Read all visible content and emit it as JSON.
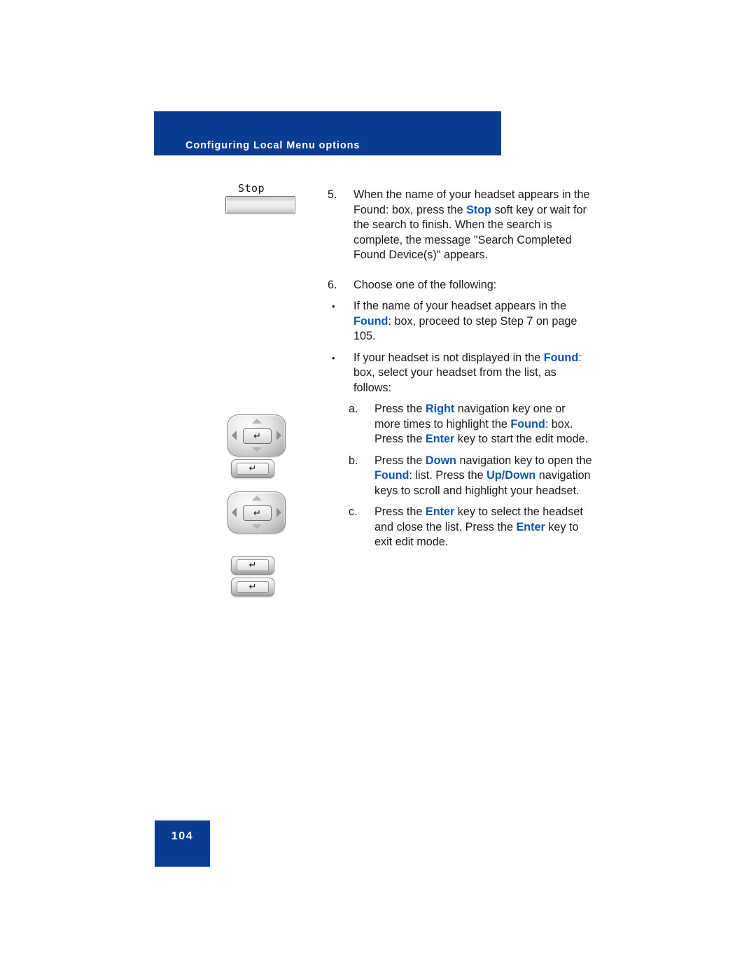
{
  "header": {
    "title": "Configuring Local Menu options",
    "background_color": "#0a3d91",
    "text_color": "#ffffff"
  },
  "accent_color": "#0d55b5",
  "figures": {
    "softkey_stop": {
      "icon": "softkey-stop-icon",
      "label": "Stop"
    },
    "nav_cluster_1": {
      "icon": "navigation-cluster-icon",
      "enter_glyph": "↵"
    },
    "enter_key_1": {
      "icon": "enter-key-icon",
      "enter_glyph": "↵"
    },
    "nav_cluster_2": {
      "icon": "navigation-cluster-icon",
      "enter_glyph": "↵"
    },
    "enter_key_2": {
      "icon": "enter-key-icon",
      "enter_glyph": "↵"
    },
    "enter_key_3": {
      "icon": "enter-key-icon",
      "enter_glyph": "↵"
    }
  },
  "content": {
    "step5": {
      "marker": "5.",
      "text_parts": [
        {
          "text": "When the name of your headset appears in the Found: box, press the ",
          "bold": false
        },
        {
          "text": "Stop",
          "bold": true
        },
        {
          "text": " soft key or wait for the search to finish. When the search is complete, the message \"Search Completed Found Device(s)\" appears.",
          "bold": false
        }
      ]
    },
    "step6": {
      "marker": "6.",
      "text": "Choose one of the following:"
    },
    "bullet1": {
      "marker": "•",
      "text_parts": [
        {
          "text": "If the name of your headset appears in the ",
          "bold": false
        },
        {
          "text": "Found",
          "bold": true
        },
        {
          "text": ": box, proceed to step Step 7 on page 105.",
          "bold": false
        }
      ]
    },
    "bullet2": {
      "marker": "•",
      "text_parts": [
        {
          "text": "If your headset is not displayed in the ",
          "bold": false
        },
        {
          "text": "Found",
          "bold": true
        },
        {
          "text": ": box, select your headset from the list, as follows:",
          "bold": false
        }
      ]
    },
    "substep_a": {
      "marker": "a.",
      "text_parts": [
        {
          "text": "Press the ",
          "bold": false
        },
        {
          "text": "Right",
          "bold": true
        },
        {
          "text": " navigation key one or more times to highlight the ",
          "bold": false
        },
        {
          "text": "Found",
          "bold": true
        },
        {
          "text": ": box. Press the ",
          "bold": false
        },
        {
          "text": "Enter",
          "bold": true
        },
        {
          "text": " key to start the edit mode.",
          "bold": false
        }
      ]
    },
    "substep_b": {
      "marker": "b.",
      "text_parts": [
        {
          "text": "Press the ",
          "bold": false
        },
        {
          "text": "Down",
          "bold": true
        },
        {
          "text": " navigation key to open the ",
          "bold": false
        },
        {
          "text": "Found",
          "bold": true
        },
        {
          "text": ": list. Press the ",
          "bold": false
        },
        {
          "text": "Up/",
          "bold": true
        },
        {
          "text": "Down",
          "bold": true
        },
        {
          "text": " navigation keys to scroll and highlight your headset.",
          "bold": false
        }
      ]
    },
    "substep_c": {
      "marker": "c.",
      "text_parts": [
        {
          "text": "Press the ",
          "bold": false
        },
        {
          "text": "Enter",
          "bold": true
        },
        {
          "text": " key to select the headset and close the list. Press the ",
          "bold": false
        },
        {
          "text": "Enter",
          "bold": true
        },
        {
          "text": " key to exit edit mode.",
          "bold": false
        }
      ]
    }
  },
  "footer": {
    "page_number": "104",
    "background_color": "#0a3d91"
  }
}
